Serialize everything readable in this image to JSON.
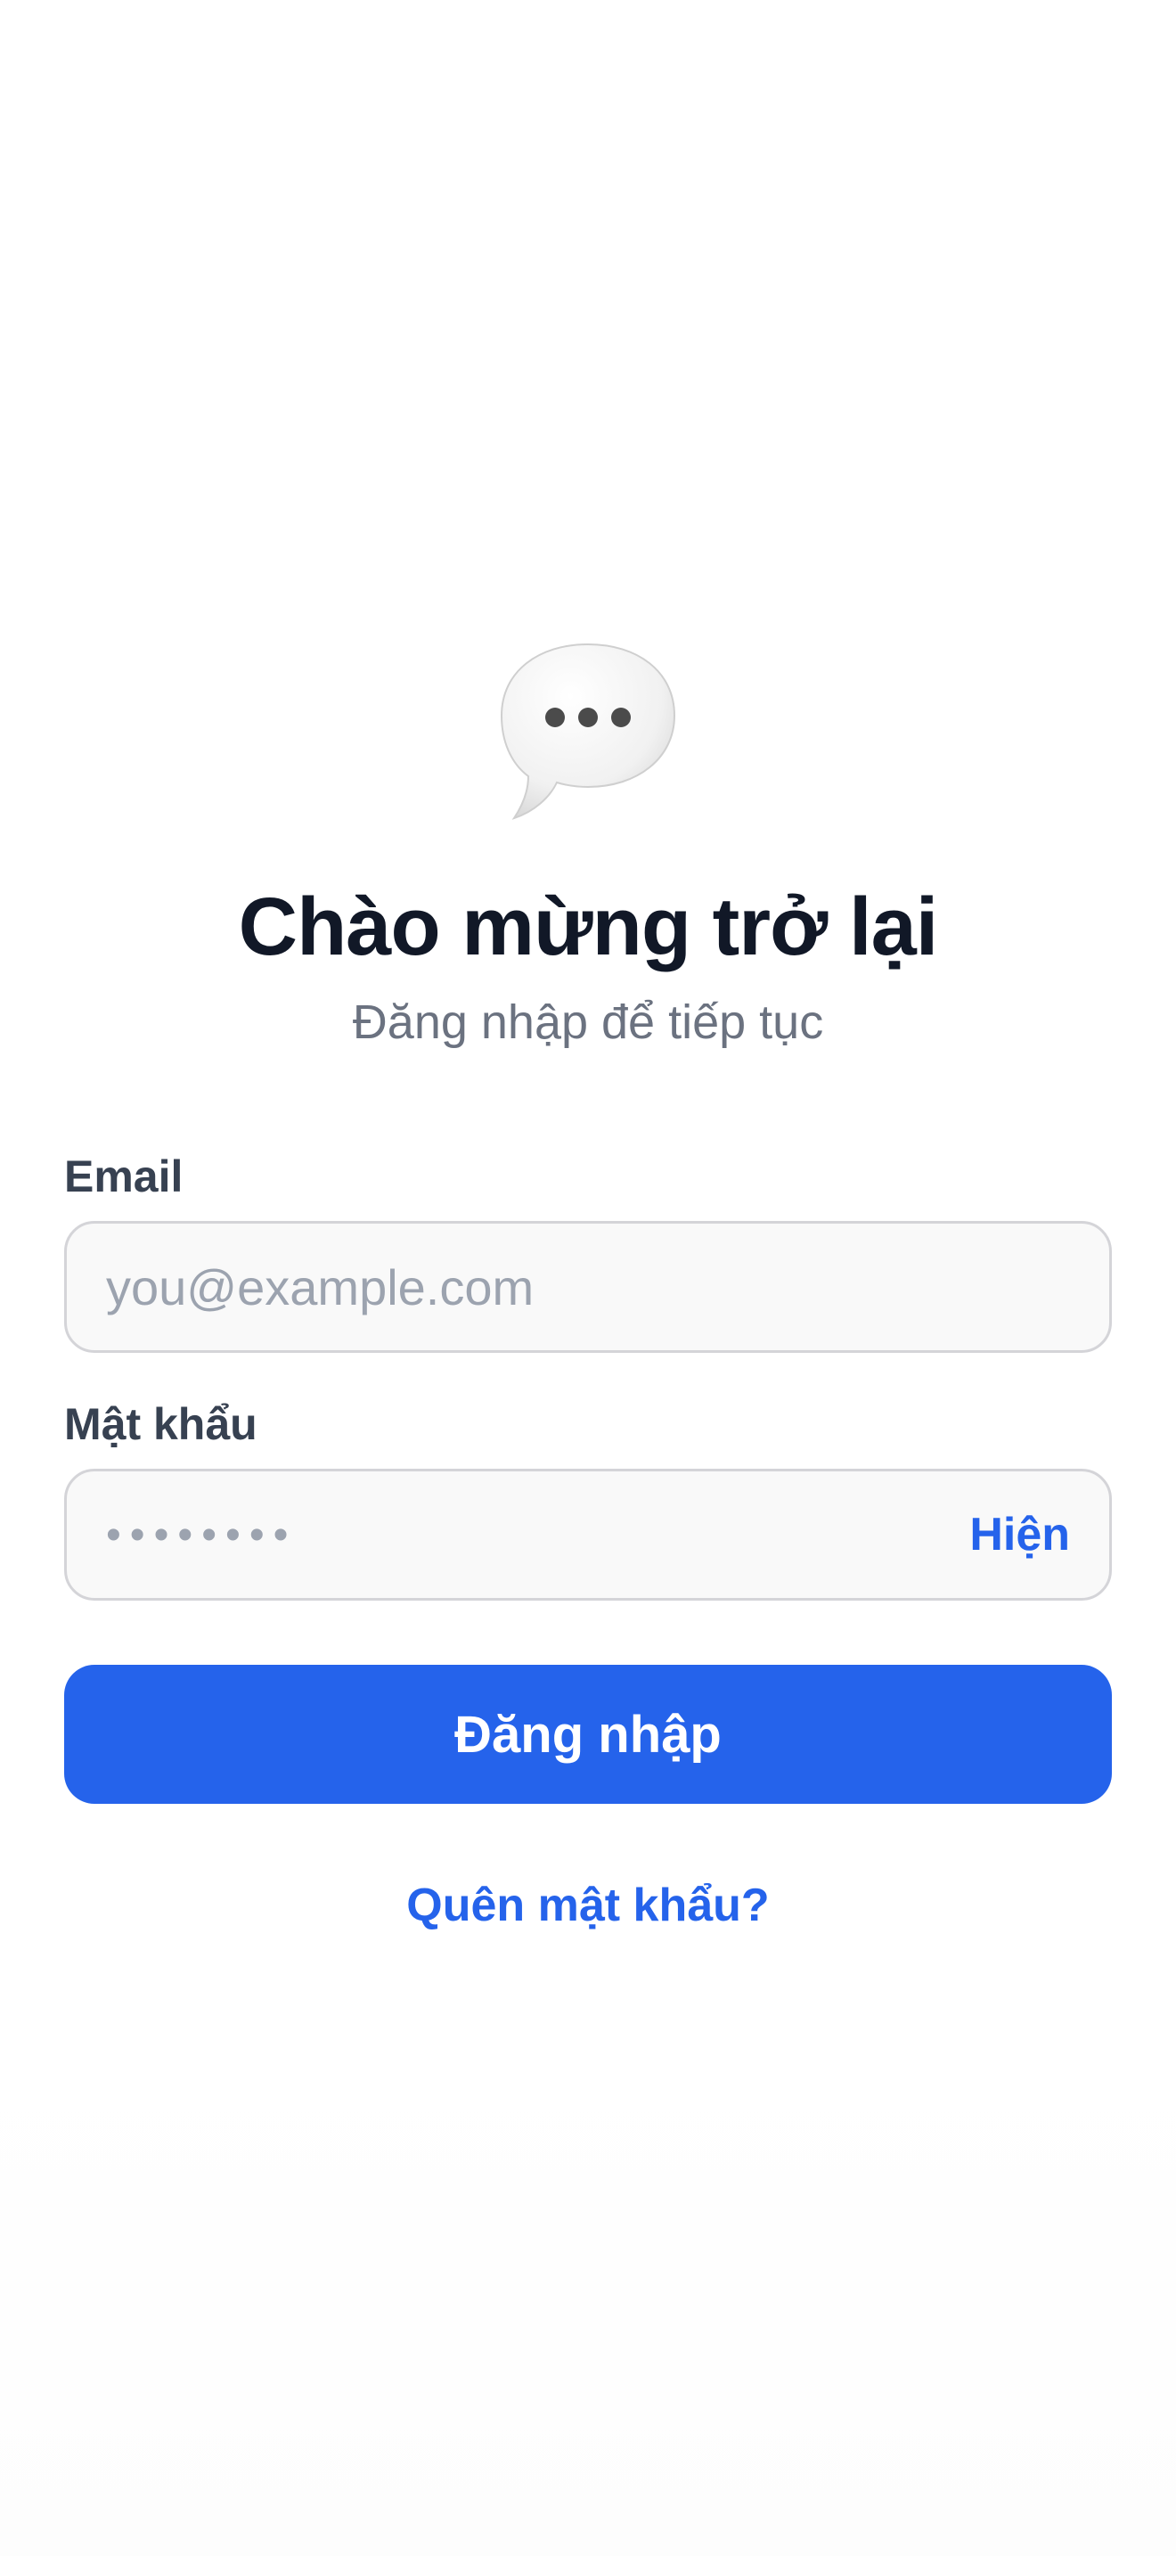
{
  "header": {
    "logo_icon": "speech-bubble-icon",
    "title": "Chào mừng trở lại",
    "subtitle": "Đăng nhập để tiếp tục"
  },
  "form": {
    "email": {
      "label": "Email",
      "value": "",
      "placeholder": "you@example.com"
    },
    "password": {
      "label": "Mật khẩu",
      "value": "",
      "placeholder": "••••••••",
      "toggle_label": "Hiện"
    },
    "submit_label": "Đăng nhập",
    "forgot_label": "Quên mật khẩu?"
  },
  "colors": {
    "accent": "#2563eb",
    "title": "#111827",
    "muted": "#6b7280",
    "field_bg": "#f9f9f9",
    "field_border": "#d4d4d8"
  }
}
